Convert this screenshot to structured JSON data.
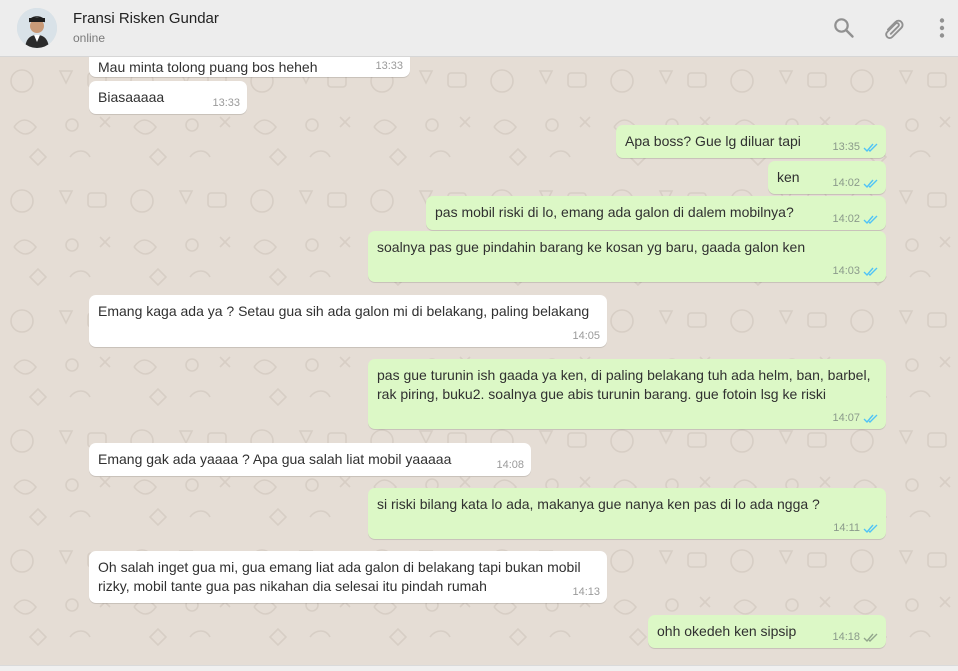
{
  "contact": {
    "name": "Fransi Risken Gundar",
    "status": "online"
  },
  "header_icons": [
    "search-icon",
    "attach-icon",
    "menu-icon"
  ],
  "colors": {
    "header_bg": "#ededed",
    "wallpaper": "#e5ddd5",
    "incoming_bubble": "#ffffff",
    "outgoing_bubble": "#dcf8c6",
    "read_tick": "#4fc3f7",
    "delivered_tick": "#92a58c"
  },
  "messages": [
    {
      "direction": "in",
      "text": "Mau minta tolong puang bos heheh",
      "time": "13:33"
    },
    {
      "direction": "in",
      "text": "Biasaaaaa",
      "time": "13:33"
    },
    {
      "direction": "out",
      "text": "Apa boss? Gue lg diluar tapi",
      "time": "13:35",
      "status": "read"
    },
    {
      "direction": "out",
      "text": "ken",
      "time": "14:02",
      "status": "read"
    },
    {
      "direction": "out",
      "text": "pas mobil riski di lo, emang ada galon di dalem mobilnya?",
      "time": "14:02",
      "status": "read"
    },
    {
      "direction": "out",
      "text": "soalnya pas gue pindahin barang ke kosan yg baru, gaada galon ken",
      "time": "14:03",
      "status": "read"
    },
    {
      "direction": "in",
      "text": "Emang kaga ada ya ? Setau gua sih ada galon mi di belakang, paling belakang",
      "time": "14:05"
    },
    {
      "direction": "out",
      "text": "pas gue turunin ish gaada ya ken, di paling belakang tuh ada helm, ban, barbel, rak piring, buku2. soalnya gue abis turunin barang. gue fotoin lsg ke riski",
      "time": "14:07",
      "status": "read"
    },
    {
      "direction": "in",
      "text": "Emang gak ada yaaaa ? Apa gua salah liat mobil yaaaaa",
      "time": "14:08"
    },
    {
      "direction": "out",
      "text": "si riski bilang kata lo ada, makanya gue nanya ken pas di lo ada ngga ?",
      "time": "14:11",
      "status": "read"
    },
    {
      "direction": "in",
      "text": "Oh salah inget gua mi, gua emang liat ada galon di belakang tapi bukan mobil rizky, mobil tante gua pas nikahan dia selesai itu pindah rumah",
      "time": "14:13"
    },
    {
      "direction": "out",
      "text": "ohh okedeh ken sipsip",
      "time": "14:18",
      "status": "delivered"
    }
  ]
}
